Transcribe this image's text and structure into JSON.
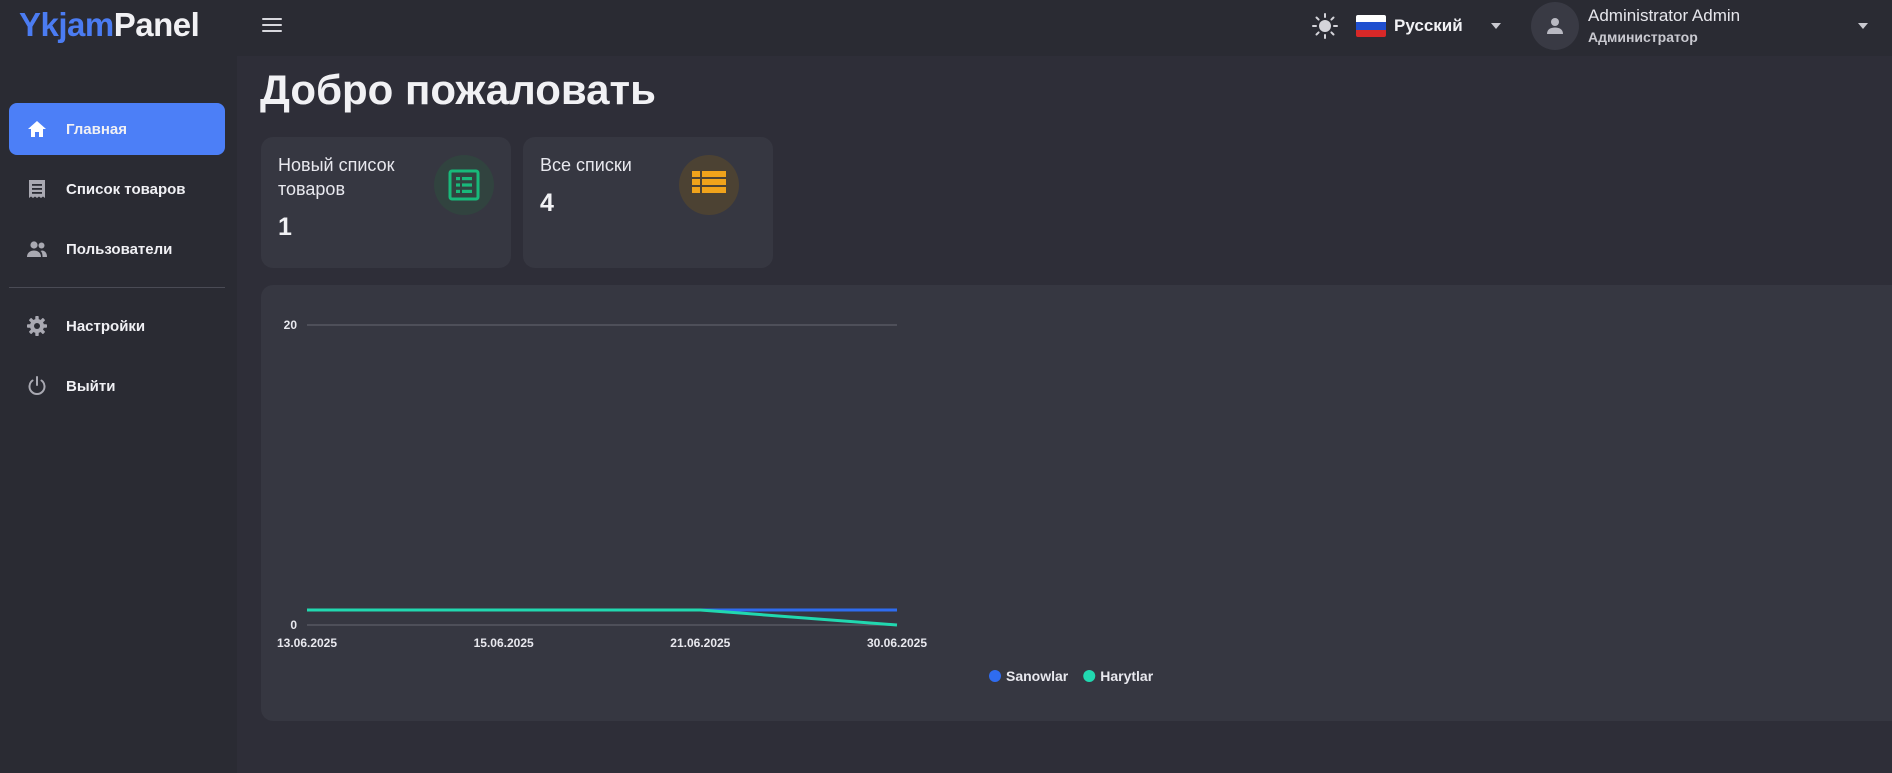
{
  "app": {
    "logo_part1": "Ykjam",
    "logo_part2": "Panel"
  },
  "header": {
    "language": "Русский",
    "user_name": "Administrator Admin",
    "user_role": "Администратор"
  },
  "sidebar": {
    "items": [
      {
        "label": "Главная",
        "icon": "home-icon",
        "active": true
      },
      {
        "label": "Список товаров",
        "icon": "receipt-icon",
        "active": false
      },
      {
        "label": "Пользователи",
        "icon": "users-icon",
        "active": false
      },
      {
        "label": "Настройки",
        "icon": "gear-icon",
        "active": false
      },
      {
        "label": "Выйти",
        "icon": "power-icon",
        "active": false
      }
    ]
  },
  "main": {
    "title": "Добро пожаловать",
    "cards": [
      {
        "label": "Новый список товаров",
        "value": "1",
        "icon": "list-alt-icon",
        "color": "#18b97a"
      },
      {
        "label": "Все списки",
        "value": "4",
        "icon": "list-icon",
        "color": "#f0a31b"
      }
    ]
  },
  "colors": {
    "accent": "#4c7ff7",
    "series_sanowlar": "#2f6cf0",
    "series_harytlar": "#21d8b0"
  },
  "chart_data": {
    "type": "line",
    "x": [
      "13.06.2025",
      "15.06.2025",
      "21.06.2025",
      "30.06.2025"
    ],
    "yticks": [
      "0",
      "20"
    ],
    "ylim": [
      0,
      20
    ],
    "series": [
      {
        "name": "Sanowlar",
        "values": [
          1,
          1,
          1,
          1
        ],
        "color": "#2f6cf0"
      },
      {
        "name": "Harytlar",
        "values": [
          1,
          1,
          1,
          0
        ],
        "color": "#21d8b0"
      }
    ],
    "legend_position": "bottom-center"
  }
}
